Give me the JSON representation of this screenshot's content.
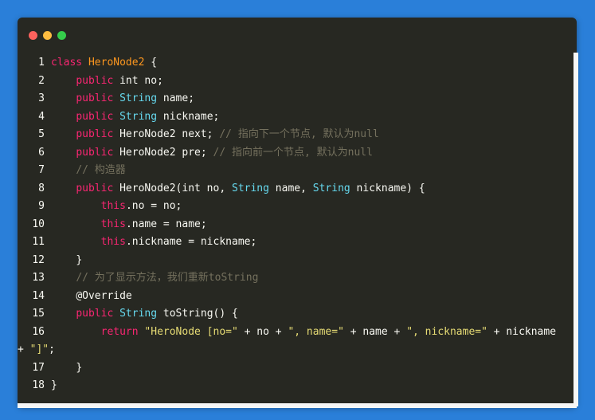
{
  "colors": {
    "background": "#2a7fd9",
    "editor_bg": "#272822",
    "keyword": "#f92672",
    "class_name": "#fd971f",
    "type": "#66d9ef",
    "comment": "#75715e",
    "string": "#e6db74",
    "plain": "#f8f8f2"
  },
  "window_controls": [
    "close",
    "minimize",
    "maximize"
  ],
  "line_numbers": [
    "1",
    "2",
    "3",
    "4",
    "5",
    "6",
    "7",
    "8",
    "9",
    "10",
    "11",
    "12",
    "13",
    "14",
    "15",
    "16",
    "17",
    "18"
  ],
  "tok": {
    "l1": [
      "class",
      " ",
      "HeroNode2",
      " {"
    ],
    "l2": [
      "    ",
      "public",
      " int no;"
    ],
    "l3": [
      "    ",
      "public",
      " ",
      "String",
      " name;"
    ],
    "l4": [
      "    ",
      "public",
      " ",
      "String",
      " nickname;"
    ],
    "l5": [
      "    ",
      "public",
      " HeroNode2 next; ",
      "// 指向下一个节点, 默认为null"
    ],
    "l6": [
      "    ",
      "public",
      " HeroNode2 pre; ",
      "// 指向前一个节点, 默认为null"
    ],
    "l7": [
      "    ",
      "// 构造器"
    ],
    "l8": [
      "    ",
      "public",
      " HeroNode2(int no, ",
      "String",
      " name, ",
      "String",
      " nickname) {"
    ],
    "l9": [
      "        ",
      "this",
      ".no = no;"
    ],
    "l10": [
      "        ",
      "this",
      ".name = name;"
    ],
    "l11": [
      "        ",
      "this",
      ".nickname = nickname;"
    ],
    "l12": [
      "    }"
    ],
    "l13": [
      "    ",
      "// 为了显示方法，我们重新toString"
    ],
    "l14": [
      "    ",
      "@Override"
    ],
    "l15": [
      "    ",
      "public",
      " ",
      "String",
      " toString() {"
    ],
    "l16": [
      "        ",
      "return",
      " ",
      "\"HeroNode [no=\"",
      " + no + ",
      "\", name=\"",
      " + name + ",
      "\", nickname=\"",
      " + nickname + ",
      "\"]\"",
      ";"
    ],
    "l17": [
      "    }"
    ],
    "l18": [
      "}"
    ]
  }
}
